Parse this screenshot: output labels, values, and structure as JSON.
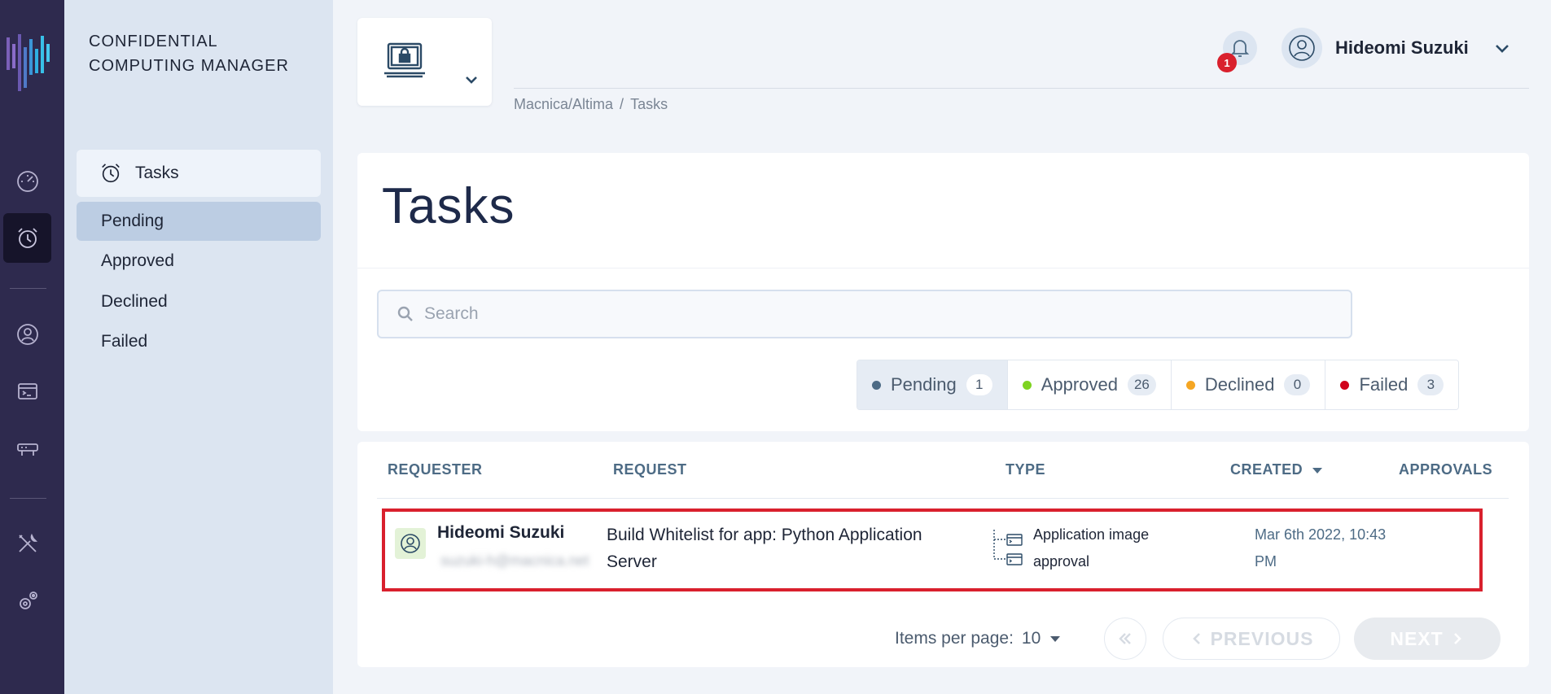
{
  "app": {
    "brand": "CONFIDENTIAL COMPUTING MANAGER"
  },
  "rail": {
    "icons": [
      "dashboard-icon",
      "alarm-clock-icon",
      "user-circle-icon",
      "terminal-icon",
      "router-icon",
      "tools-icon",
      "settings-gears-icon"
    ]
  },
  "sidebar": {
    "section_label": "Tasks",
    "items": [
      {
        "label": "Pending"
      },
      {
        "label": "Approved"
      },
      {
        "label": "Declined"
      },
      {
        "label": "Failed"
      }
    ]
  },
  "header": {
    "notification_count": "1",
    "user_name": "Hideomi Suzuki",
    "breadcrumb": [
      "Macnica/Altima",
      "/",
      "Tasks"
    ]
  },
  "page": {
    "title": "Tasks",
    "search_placeholder": "Search"
  },
  "filters": [
    {
      "label": "Pending",
      "count": "1",
      "color": "#4d6b85"
    },
    {
      "label": "Approved",
      "count": "26",
      "color": "#7ed321"
    },
    {
      "label": "Declined",
      "count": "0",
      "color": "#f5a623"
    },
    {
      "label": "Failed",
      "count": "3",
      "color": "#d0021b"
    }
  ],
  "table": {
    "columns": [
      "REQUESTER",
      "REQUEST",
      "TYPE",
      "CREATED",
      "APPROVALS"
    ],
    "rows": [
      {
        "requester_name": "Hideomi Suzuki",
        "requester_email": "suzuki-h@macnica.net",
        "request": "Build Whitelist for app: Python Application Server",
        "type": "Application image approval",
        "created": "Mar 6th 2022, 10:43 PM",
        "approvals": ""
      }
    ]
  },
  "pagination": {
    "items_per_page_label": "Items per page:",
    "items_per_page_value": "10",
    "previous_label": "PREVIOUS",
    "next_label": "NEXT"
  },
  "colors": {
    "rail_bg": "#2e2a4e",
    "sidebar_bg": "#dce5f1",
    "highlight_border": "#d9202d",
    "badge": "#d9202d"
  }
}
